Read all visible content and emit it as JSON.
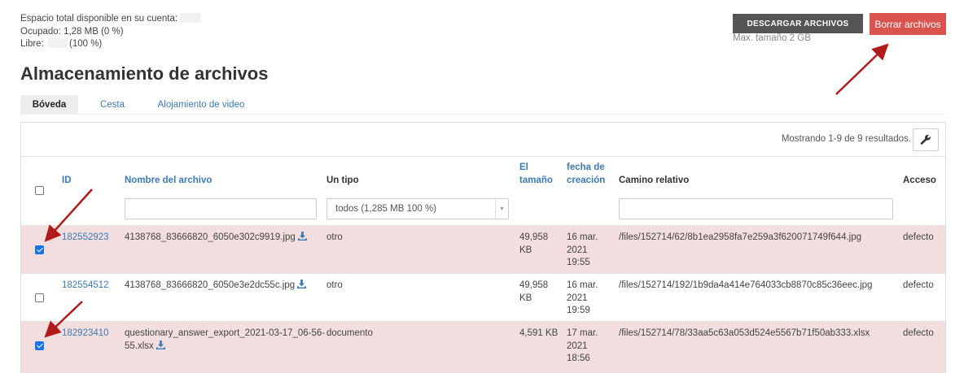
{
  "storage": {
    "total_label": "Espacio total disponible en su cuenta:",
    "used_label": "Ocupado: 1,28 MB (0 %)",
    "free_label": "Libre:",
    "free_percent": "(100 %)"
  },
  "actions": {
    "download_label": "DESCARGAR ARCHIVOS",
    "delete_label": "Borrar archivos",
    "max_size": "Max. tamaño 2 GB"
  },
  "page_title": "Almacenamiento de archivos",
  "tabs": [
    {
      "label": "Bóveda",
      "active": true
    },
    {
      "label": "Cesta",
      "active": false
    },
    {
      "label": "Alojamiento de video",
      "active": false
    }
  ],
  "table": {
    "showing": "Mostrando 1-9 de 9 resultados.",
    "headers": {
      "id": "ID",
      "name": "Nombre del archivo",
      "type": "Un tipo",
      "size_1": "El",
      "size_2": "tamaño",
      "date_1": "fecha de",
      "date_2": "creación",
      "path": "Camino relativo",
      "access": "Acceso"
    },
    "filters": {
      "type_selected": "todos (1,285 MB 100 %)"
    },
    "rows": [
      {
        "selected": true,
        "id": "182552923",
        "name_1": "4138768_83666820_6050e302c9919.jpg",
        "name_2": "",
        "type": "otro",
        "size_1": "49,958",
        "size_2": "KB",
        "date_1": "16 mar.",
        "date_2": "2021",
        "date_3": "19:55",
        "path": "/files/152714/62/8b1ea2958fa7e259a3f620071749f644.jpg",
        "access": "defecto"
      },
      {
        "selected": false,
        "id": "182554512",
        "name_1": "4138768_83666820_6050e3e2dc55c.jpg",
        "name_2": "",
        "type": "otro",
        "size_1": "49,958",
        "size_2": "KB",
        "date_1": "16 mar.",
        "date_2": "2021",
        "date_3": "19:59",
        "path": "/files/152714/192/1b9da4a414e764033cb8870c85c36eec.jpg",
        "access": "defecto"
      },
      {
        "selected": true,
        "id": "182923410",
        "name_1": "questionary_answer_export_2021-03-17_06-56-",
        "name_2": "55.xlsx",
        "type": "documento",
        "size_1": "4,591 KB",
        "size_2": "",
        "date_1": "17 mar.",
        "date_2": "2021",
        "date_3": "18:56",
        "path": "/files/152714/78/33aa5c63a053d524e5567b71f50ab333.xlsx",
        "access": "defecto"
      }
    ]
  },
  "colors": {
    "link": "#3d7ab5",
    "delete_button": "#d9534f",
    "download_button": "#555555",
    "selected_row": "#f2dede",
    "annotation_arrow": "#b01c1c"
  }
}
